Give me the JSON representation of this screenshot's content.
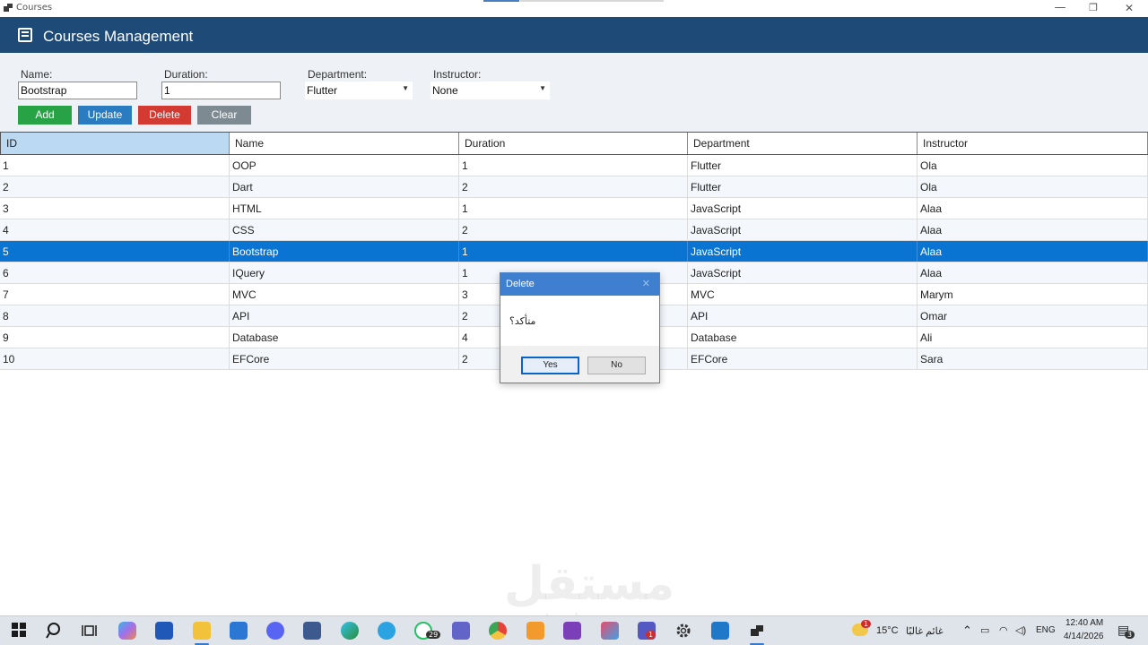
{
  "window": {
    "title": "Courses",
    "min": "—",
    "max": "❐",
    "close": "✕"
  },
  "header": {
    "title": "Courses Management"
  },
  "form": {
    "name_label": "Name:",
    "name_value": "Bootstrap",
    "duration_label": "Duration:",
    "duration_value": "1",
    "department_label": "Department:",
    "department_value": "Flutter",
    "instructor_label": "Instructor:",
    "instructor_value": "None",
    "add": "Add",
    "update": "Update",
    "delete": "Delete",
    "clear": "Clear"
  },
  "grid": {
    "columns": [
      "ID",
      "Name",
      "Duration",
      "Department",
      "Instructor"
    ],
    "rows": [
      [
        "1",
        "OOP",
        "1",
        "Flutter",
        "Ola"
      ],
      [
        "2",
        "Dart",
        "2",
        "Flutter",
        "Ola"
      ],
      [
        "3",
        "HTML",
        "1",
        "JavaScript",
        "Alaa"
      ],
      [
        "4",
        "CSS",
        "2",
        "JavaScript",
        "Alaa"
      ],
      [
        "5",
        "Bootstrap",
        "1",
        "JavaScript",
        "Alaa"
      ],
      [
        "6",
        "IQuery",
        "1",
        "JavaScript",
        "Alaa"
      ],
      [
        "7",
        "MVC",
        "3",
        "MVC",
        "Marym"
      ],
      [
        "8",
        "API",
        "2",
        "API",
        "Omar"
      ],
      [
        "9",
        "Database",
        "4",
        "Database",
        "Ali"
      ],
      [
        "10",
        "EFCore",
        "2",
        "EFCore",
        "Sara"
      ]
    ],
    "selected_row": 4
  },
  "dialog": {
    "title": "Delete",
    "close": "✕",
    "message": "متأكد؟",
    "yes": "Yes",
    "no": "No"
  },
  "watermark": {
    "text": "مستقل",
    "sub": "mostaql.com"
  },
  "taskbar": {
    "whatsapp_badge": "29",
    "teams_badge": "1",
    "weather_badge": "1",
    "temperature": "15°C",
    "weather_desc": "غائم غالبًا",
    "language": "ENG",
    "time": "12:40 AM",
    "date": "4/14/2026",
    "notifications": "3"
  },
  "colors": {
    "header": "#1e4a78",
    "add": "#27a346",
    "update": "#2a7bbf",
    "delete": "#d33a32",
    "clear": "#7d8a91",
    "selected": "#0a74d2"
  }
}
